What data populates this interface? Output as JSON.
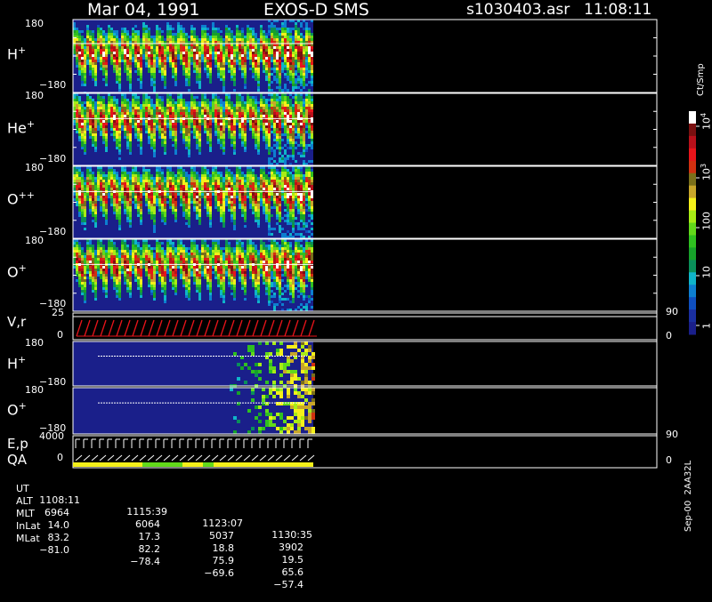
{
  "header": {
    "date": "Mar 04, 1991",
    "instrument": "EXOS-D SMS",
    "file": "s1030403.asr",
    "time": "11:08:11"
  },
  "panels": [
    {
      "label_base": "H",
      "label_sup": "+",
      "top_tick": "180",
      "bottom_tick": "−180"
    },
    {
      "label_base": "He",
      "label_sup": "+",
      "top_tick": "180",
      "bottom_tick": "−180"
    },
    {
      "label_base": "O",
      "label_sup": "++",
      "top_tick": "180",
      "bottom_tick": "−180"
    },
    {
      "label_base": "O",
      "label_sup": "+",
      "top_tick": "180",
      "bottom_tick": "−180"
    }
  ],
  "vr_panel": {
    "label": "V,r",
    "left_top": "25",
    "left_bottom": "0",
    "right_top": "90",
    "right_bottom": "0"
  },
  "small_panels": [
    {
      "label_base": "H",
      "label_sup": "+",
      "top_tick": "180",
      "bottom_tick": "−180"
    },
    {
      "label_base": "O",
      "label_sup": "+",
      "top_tick": "180",
      "bottom_tick": "−180"
    }
  ],
  "ep_panel": {
    "label1": "E,p",
    "label2": "QA",
    "left_top": "4000",
    "left_bottom": "0",
    "right_top": "90",
    "right_bottom": "0"
  },
  "colorbar": {
    "unit": "Ct/Smp",
    "ticks": [
      {
        "base": "10",
        "sup": "4"
      },
      {
        "base": "10",
        "sup": "3"
      },
      {
        "base": "100",
        "sup": ""
      },
      {
        "base": "10",
        "sup": ""
      },
      {
        "base": "1",
        "sup": ""
      }
    ],
    "colors": [
      "#1a1f8a",
      "#1a2fa0",
      "#0f4fbf",
      "#0d7fd0",
      "#0fb4c9",
      "#0a8f5a",
      "#17a12a",
      "#2fc020",
      "#62d91a",
      "#a8ec15",
      "#f4f01a",
      "#c8a62a",
      "#7a6f1a",
      "#d03010",
      "#e8141a",
      "#b8101a",
      "#7a1010",
      "#ffffff"
    ]
  },
  "footer_text": "Sep-00  2AA32L",
  "table": {
    "rows": [
      {
        "name": "UT",
        "values": [
          "1108:11",
          "1115:39",
          "1123:07",
          "1130:35"
        ]
      },
      {
        "name": "ALT",
        "values": [
          "6964",
          "6064",
          "5037",
          "3902"
        ]
      },
      {
        "name": "MLT",
        "values": [
          "14.0",
          "17.3",
          "18.8",
          "19.5"
        ]
      },
      {
        "name": "InLat",
        "values": [
          "83.2",
          "82.2",
          "75.9",
          "65.6"
        ]
      },
      {
        "name": "MLat",
        "values": [
          "−81.0",
          "−78.4",
          "−69.6",
          "−57.4"
        ]
      }
    ]
  },
  "chart_data": {
    "type": "heatmap",
    "title": "Mar 04, 1991   EXOS-D SMS",
    "x_ticks_ut": [
      "1108:11",
      "1115:39",
      "1123:07",
      "1130:35"
    ],
    "y_range_pitch_angle": [
      -180,
      180
    ],
    "colorbar_range_ct_per_smp": [
      1,
      10000
    ],
    "colorbar_scale": "log",
    "series": [
      {
        "name": "H+"
      },
      {
        "name": "He+"
      },
      {
        "name": "O++"
      },
      {
        "name": "O+"
      },
      {
        "name": "V,r"
      },
      {
        "name": "H+"
      },
      {
        "name": "O+"
      },
      {
        "name": "E,p"
      },
      {
        "name": "QA"
      }
    ],
    "data_coverage_ut": [
      "1108:11",
      "~1133:00"
    ]
  }
}
